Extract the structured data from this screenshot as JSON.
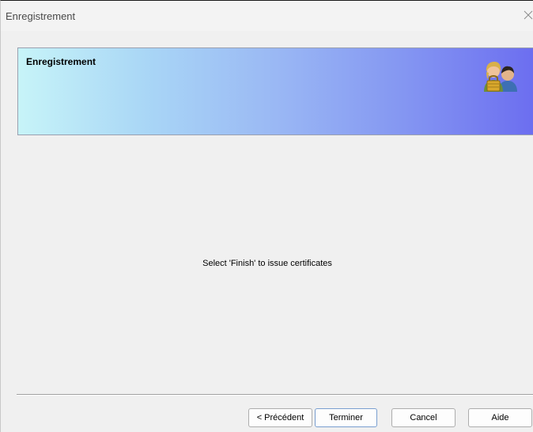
{
  "window": {
    "title": "Enregistrement"
  },
  "header": {
    "title": "Enregistrement",
    "icon": "user-certificate-icon"
  },
  "body": {
    "message": "Select 'Finish' to issue certificates"
  },
  "buttons": {
    "back_label": "< Précédent",
    "finish_label": "Terminer",
    "cancel_label": "Cancel",
    "help_label": "Aide"
  },
  "colors": {
    "window_bg": "#f0f0f0",
    "banner_gradient_start": "#c7f4f8",
    "banner_gradient_end": "#6c6ef0"
  }
}
